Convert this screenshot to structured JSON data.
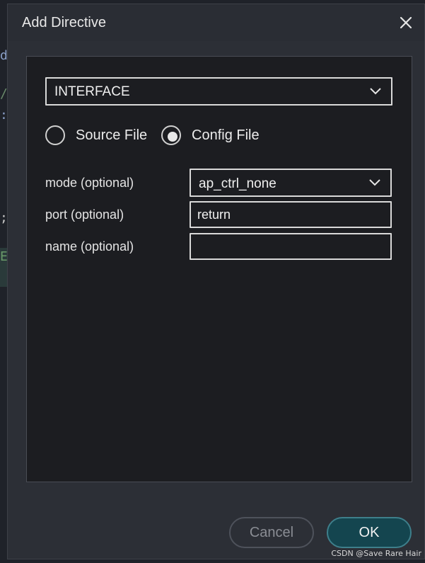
{
  "background_code": {
    "fragments": [
      "d",
      "/",
      ":",
      ";",
      "E"
    ],
    "colors": [
      "#8ba0c8",
      "#6a8a6a",
      "#8ba0c8",
      "#c8c8c8",
      "#6a9a6a"
    ]
  },
  "dialog": {
    "title": "Add Directive",
    "close_icon": "close-icon"
  },
  "directive_select": {
    "value": "INTERFACE",
    "icon": "chevron-down-icon"
  },
  "destination": {
    "options": [
      {
        "label": "Source File",
        "selected": false
      },
      {
        "label": "Config File",
        "selected": true
      }
    ]
  },
  "fields": {
    "mode": {
      "label": "mode (optional)",
      "value": "ap_ctrl_none"
    },
    "port": {
      "label": "port (optional)",
      "value": "return",
      "placeholder": ""
    },
    "name": {
      "label": "name (optional)",
      "value": "",
      "placeholder": ""
    }
  },
  "buttons": {
    "cancel": "Cancel",
    "ok": "OK"
  },
  "watermark": "CSDN @Save Rare Hair",
  "colors": {
    "dialog_bg": "#2c2f36",
    "panel_bg": "#1c1d21",
    "ok_bg": "#14454f",
    "ok_border": "#3e7f8b"
  }
}
